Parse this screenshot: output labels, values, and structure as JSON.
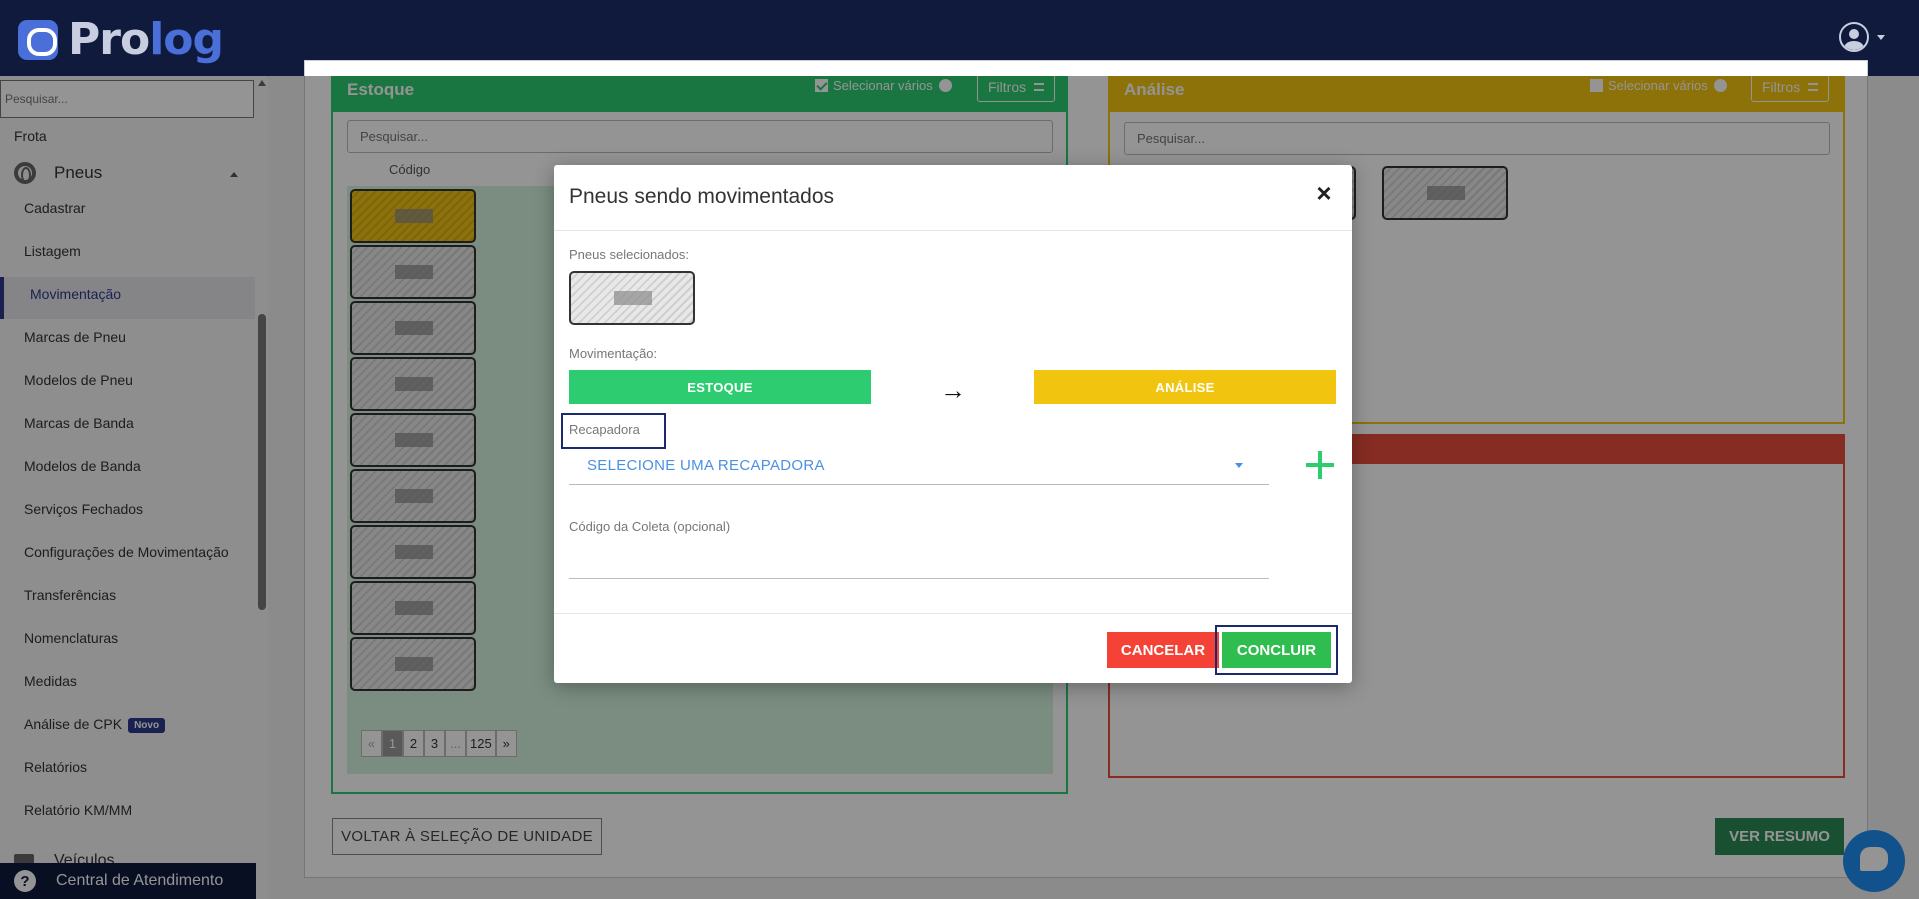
{
  "header": {
    "logo_prefix": "Pro",
    "logo_suffix": "log"
  },
  "sidebar": {
    "search_placeholder": "Pesquisar...",
    "frota": "Frota",
    "pneus": "Pneus",
    "items": [
      "Cadastrar",
      "Listagem",
      "Movimentação",
      "Marcas de Pneu",
      "Modelos de Pneu",
      "Marcas de Banda",
      "Modelos de Banda",
      "Serviços Fechados",
      "Configurações de Movimentação",
      "Transferências",
      "Nomenclaturas",
      "Medidas",
      "Análise de CPK",
      "Relatórios",
      "Relatório KM/MM"
    ],
    "badge_new": "Novo",
    "veiculos": "Veículos",
    "help": "Central de Atendimento"
  },
  "estoque": {
    "title": "Estoque",
    "select_many": "Selecionar vários",
    "filters": "Filtros",
    "search_placeholder": "Pesquisar...",
    "col_code": "Código",
    "pagination": [
      "«",
      "1",
      "2",
      "3",
      "...",
      "125",
      "»"
    ]
  },
  "analise": {
    "title": "Análise",
    "select_many": "Selecionar vários",
    "filters": "Filtros",
    "search_placeholder": "Pesquisar..."
  },
  "footer": {
    "back": "VOLTAR À SELEÇÃO DE UNIDADE",
    "summary": "VER RESUMO"
  },
  "modal": {
    "title": "Pneus sendo movimentados",
    "selected_label": "Pneus selecionados:",
    "movement_label": "Movimentação:",
    "from": "ESTOQUE",
    "to": "ANÁLISE",
    "arrow": "→",
    "recapadora_label": "Recapadora",
    "recapadora_select": "SELECIONE UMA RECAPADORA",
    "coleta_label": "Código da Coleta (opcional)",
    "coleta_value": "",
    "cancel": "CANCELAR",
    "confirm": "CONCLUIR",
    "close": "×"
  },
  "colors": {
    "estoque": "#2ecc71",
    "analise": "#f1c40f",
    "descarte": "#e74c3c",
    "navy": "#0f1a3d",
    "accent": "#2d3a8c"
  }
}
